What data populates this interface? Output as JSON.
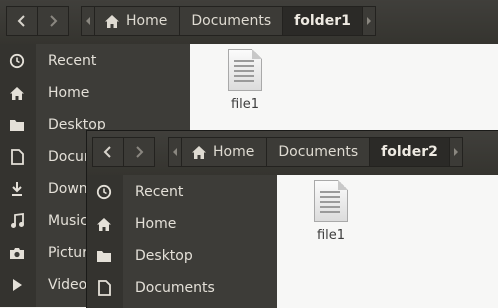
{
  "back_window": {
    "breadcrumbs": [
      {
        "label": "Home",
        "icon": "home-icon",
        "active": false
      },
      {
        "label": "Documents",
        "active": false
      },
      {
        "label": "folder1",
        "active": true
      }
    ],
    "sidebar": {
      "items": [
        {
          "label": "Recent",
          "icon": "recent-icon"
        },
        {
          "label": "Home",
          "icon": "home-icon"
        },
        {
          "label": "Desktop",
          "icon": "folder-icon"
        },
        {
          "label": "Documents",
          "icon": "document-icon"
        },
        {
          "label": "Downloads",
          "icon": "download-icon"
        },
        {
          "label": "Music",
          "icon": "music-icon"
        },
        {
          "label": "Pictures",
          "icon": "camera-icon"
        },
        {
          "label": "Videos",
          "icon": "video-icon"
        }
      ]
    },
    "files": [
      {
        "name": "file1",
        "icon": "text-file-icon"
      }
    ]
  },
  "front_window": {
    "breadcrumbs": [
      {
        "label": "Home",
        "icon": "home-icon",
        "active": false
      },
      {
        "label": "Documents",
        "active": false
      },
      {
        "label": "folder2",
        "active": true
      }
    ],
    "sidebar": {
      "items": [
        {
          "label": "Recent",
          "icon": "recent-icon"
        },
        {
          "label": "Home",
          "icon": "home-icon"
        },
        {
          "label": "Desktop",
          "icon": "folder-icon"
        },
        {
          "label": "Documents",
          "icon": "document-icon"
        }
      ]
    },
    "files": [
      {
        "name": "file1",
        "icon": "text-file-icon"
      }
    ]
  },
  "colors": {
    "header_bg": "#3c3b37",
    "sidebar_bg": "#3d3c38",
    "content_bg": "#f7f7f6",
    "sidebar_text": "#e4e0d8"
  }
}
